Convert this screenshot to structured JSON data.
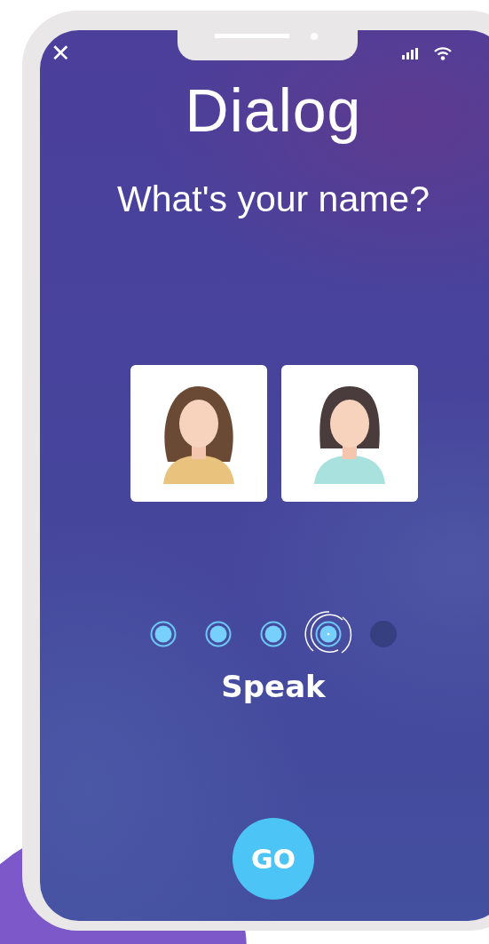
{
  "status_bar": {
    "close": "✕"
  },
  "title": "Dialog",
  "question": "What's your name?",
  "avatars": [
    {
      "kind": "long-hair"
    },
    {
      "kind": "bob-hair"
    }
  ],
  "steps": [
    {
      "kind": "done"
    },
    {
      "kind": "done"
    },
    {
      "kind": "done"
    },
    {
      "kind": "current"
    },
    {
      "kind": "pending"
    }
  ],
  "action_label": "Speak",
  "go_button": "GO"
}
